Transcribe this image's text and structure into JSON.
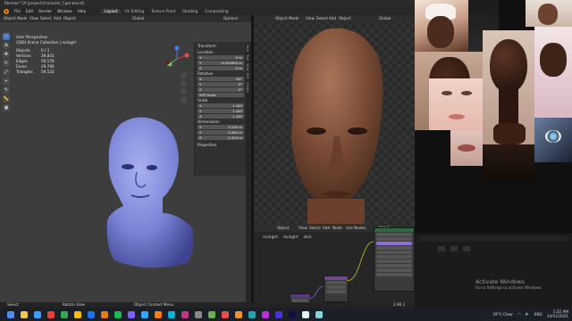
{
  "window": {
    "title": "Blender* [X:\\project\\character_f.get.blend]",
    "controls": [
      "—",
      "□",
      "✕"
    ]
  },
  "menubar": {
    "menus": [
      "File",
      "Edit",
      "Render",
      "Window",
      "Help"
    ],
    "tabs": [
      "Layout",
      "UV Editing",
      "Texture Paint",
      "Shading",
      "Compositing"
    ],
    "active_tab": "Layout"
  },
  "left_viewport": {
    "mode": "Object Mode",
    "header_items": [
      "View",
      "Select",
      "Add",
      "Object"
    ],
    "orientation": "Global",
    "overlay": {
      "view_name": "User Perspective",
      "collection": "(180) Scene Collection | rockgirl",
      "stats": [
        {
          "label": "Objects",
          "value": "0 / 1"
        },
        {
          "label": "Vertices",
          "value": "29,831"
        },
        {
          "label": "Edges",
          "value": "59,576"
        },
        {
          "label": "Faces",
          "value": "29,766"
        },
        {
          "label": "Triangles",
          "value": "59,532"
        }
      ]
    },
    "options_label": "Options",
    "npanel": {
      "transform_title": "Transform",
      "location_label": "Location",
      "location": [
        {
          "axis": "X",
          "value": "0 m"
        },
        {
          "axis": "Y",
          "value": "-0.020694 m"
        },
        {
          "axis": "Z",
          "value": "0 m"
        }
      ],
      "rotation_label": "Rotation",
      "rotation": [
        {
          "axis": "X",
          "value": "90°"
        },
        {
          "axis": "Y",
          "value": "0°"
        },
        {
          "axis": "Z",
          "value": "0°"
        }
      ],
      "rotation_mode": "XYZ Euler",
      "scale_label": "Scale",
      "scale": [
        {
          "axis": "X",
          "value": "1.163"
        },
        {
          "axis": "Y",
          "value": "1.163"
        },
        {
          "axis": "Z",
          "value": "1.163"
        }
      ],
      "dimensions_label": "Dimensions",
      "dimensions": [
        {
          "axis": "X",
          "value": "0.259 m"
        },
        {
          "axis": "Y",
          "value": "0.383 m"
        },
        {
          "axis": "Z",
          "value": "0.313 m"
        }
      ],
      "properties_label": "Properties"
    },
    "side_tabs": [
      "Item",
      "Tool",
      "View",
      "Edit",
      "Create"
    ]
  },
  "right_viewport": {
    "mode": "Object Mode",
    "header_items": [
      "View",
      "Select",
      "Add",
      "Object"
    ],
    "orientation": "Global"
  },
  "shader_editor": {
    "type_label": "Object",
    "header_items": [
      "View",
      "Select",
      "Add",
      "Node"
    ],
    "use_nodes": "Use Nodes",
    "slot": "Slot 1",
    "breadcrumb": [
      "rockgirl",
      "rockgirl",
      "skin"
    ]
  },
  "status_bar": {
    "items": [
      "Select",
      "Rotate View",
      "Object Context Menu"
    ],
    "version": "2.90.1"
  },
  "activation": {
    "line1": "Activate Windows",
    "line2": "Go to Settings to activate Windows."
  },
  "taskbar": {
    "icon_colors": [
      "#4c8df6",
      "#f2c94c",
      "#3aa0ff",
      "#e94235",
      "#34a853",
      "#fbbc04",
      "#1a73e8",
      "#e87d0d",
      "#1db954",
      "#7b61ff",
      "#31a8ff",
      "#ff7c00",
      "#00b4d8",
      "#c13584",
      "#888888",
      "#6ab04c",
      "#eb4d4b",
      "#f0932b",
      "#22a6b3",
      "#be2edd",
      "#4834d4",
      "#130f40",
      "#dff9fb",
      "#7ed6df"
    ],
    "weather": "29°C  Clear",
    "lang": "ENG",
    "time": "1:22 AM",
    "date": "14/11/2021"
  },
  "colors": {
    "accent": "#4772b3",
    "blender_orange": "#e87d0d",
    "viewport_bg": "#3d3d3d",
    "model_tint": "#7a84d6"
  }
}
